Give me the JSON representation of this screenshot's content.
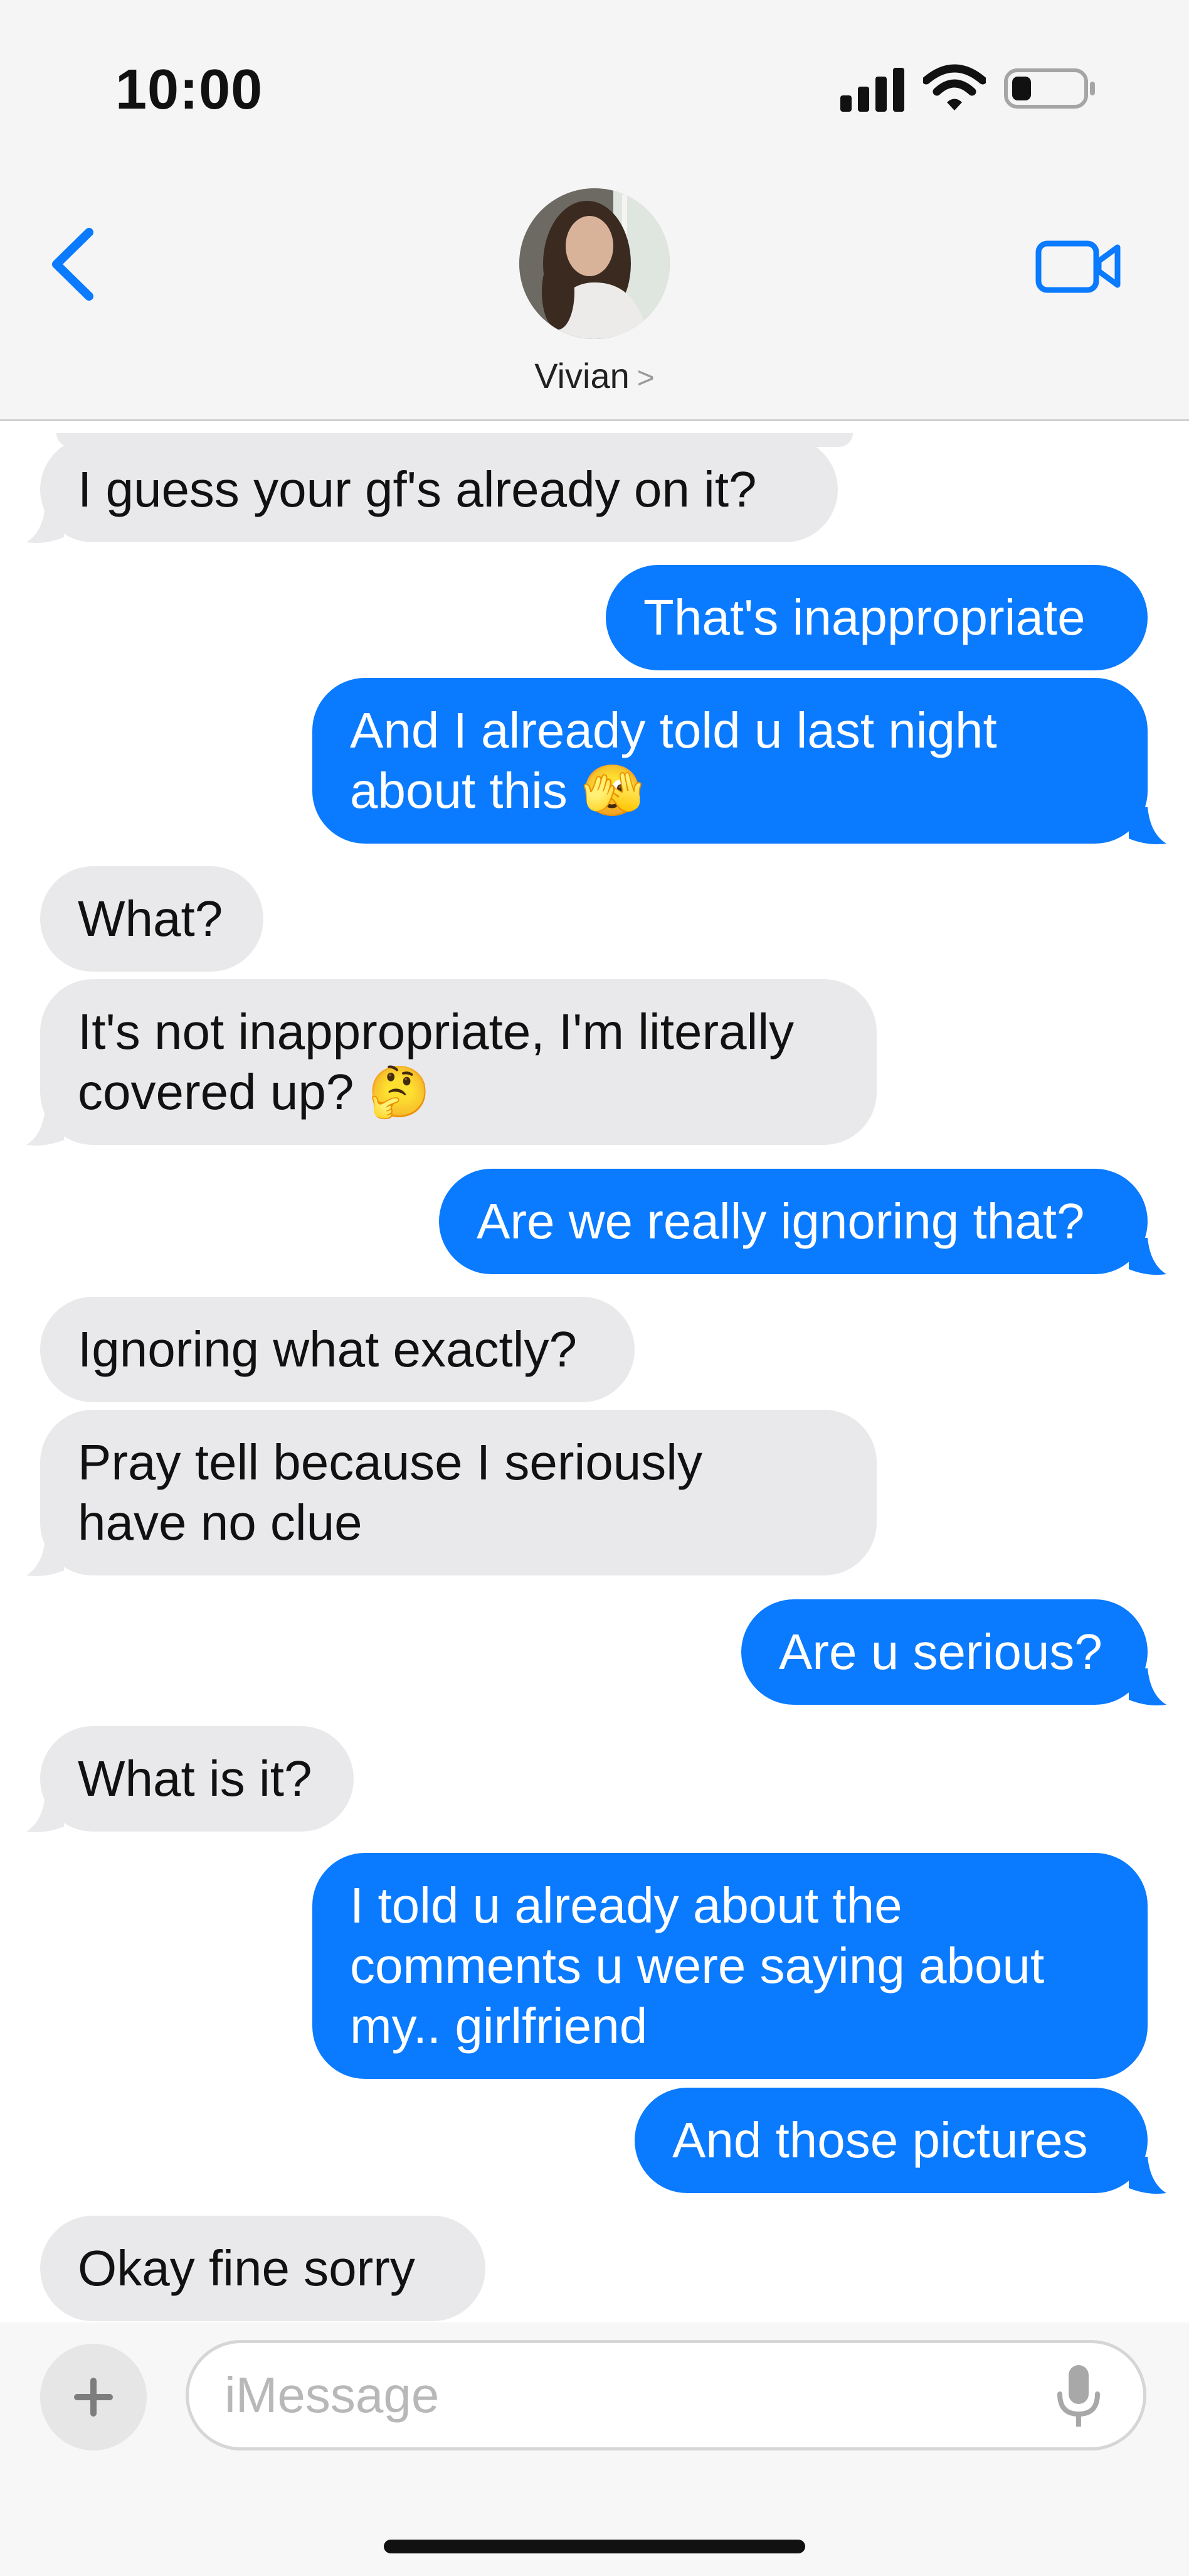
{
  "status": {
    "time": "10:00",
    "battery_level": 0.28
  },
  "header": {
    "contact_name": "Vivian",
    "contact_chevron": ">"
  },
  "messages": [
    {
      "from": "them",
      "text": "I guess your gf's already on it?"
    },
    {
      "from": "me",
      "text": "That's inappropriate"
    },
    {
      "from": "me",
      "lines": [
        "And I already told u last night",
        "about this 🫣"
      ]
    },
    {
      "from": "them",
      "text": "What?"
    },
    {
      "from": "them",
      "lines": [
        "It's not inappropriate, I'm literally",
        "covered up? 🤔"
      ]
    },
    {
      "from": "me",
      "text": "Are we really ignoring that?"
    },
    {
      "from": "them",
      "text": "Ignoring what exactly?"
    },
    {
      "from": "them",
      "lines": [
        "Pray tell because I seriously",
        "have no clue"
      ]
    },
    {
      "from": "me",
      "text": "Are u serious?"
    },
    {
      "from": "them",
      "text": "What is it?"
    },
    {
      "from": "me",
      "lines": [
        "I told u already about the",
        "comments u were saying about",
        "my.. girlfriend"
      ]
    },
    {
      "from": "me",
      "text": "And those pictures"
    },
    {
      "from": "them",
      "text": "Okay fine sorry"
    }
  ],
  "input": {
    "placeholder": "iMessage",
    "plus": "+"
  },
  "colors": {
    "outgoing": "#0a7aff",
    "incoming": "#e9e9eb",
    "accent": "#0a7aff"
  },
  "icons": [
    "back-chevron-icon",
    "video-camera-icon",
    "signal-icon",
    "wifi-icon",
    "battery-icon",
    "plus-icon",
    "microphone-icon"
  ]
}
